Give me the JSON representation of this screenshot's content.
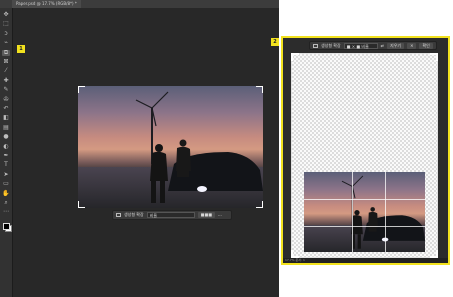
{
  "document_tab": {
    "title": "Paper.psd @ 17.7% (RGB/8*) *"
  },
  "toolbar": {
    "icons": [
      "move-icon",
      "marquee-icon",
      "lasso-icon",
      "object-select-icon",
      "crop-icon",
      "frame-icon",
      "eyedropper-icon",
      "healing-icon",
      "brush-icon",
      "stamp-icon",
      "history-brush-icon",
      "eraser-icon",
      "gradient-icon",
      "blur-icon",
      "dodge-icon",
      "pen-icon",
      "type-icon",
      "path-select-icon",
      "shape-icon",
      "hand-icon",
      "zoom-icon",
      "more-icon"
    ],
    "glyphs": [
      "✥",
      "⬚",
      "ↄ",
      "⌁",
      "⧉",
      "⊠",
      "⁄",
      "✚",
      "✎",
      "✇",
      "↶",
      "◧",
      "▤",
      "●",
      "◐",
      "✒",
      "T",
      "➤",
      "▭",
      "✋",
      "⌕",
      "⋯"
    ],
    "selected_index": 4
  },
  "callouts": {
    "left": "1",
    "right": "2"
  },
  "context_bar": {
    "fill_label": "생성형 확장",
    "field_value": "비율",
    "generate_label": "■■■",
    "more_label": "···"
  },
  "zoom_bar": {
    "fill_label": "생성형 확장",
    "field_value": "■ × ■ 비율",
    "swap_label": "⇄",
    "clear_label": "지우기",
    "cancel_label": "✕",
    "confirm_label": "확인"
  },
  "status": {
    "text": "17.7%  문서: 1"
  },
  "colors": {
    "highlight": "#f2e21e",
    "panel_bg": "#282828"
  }
}
